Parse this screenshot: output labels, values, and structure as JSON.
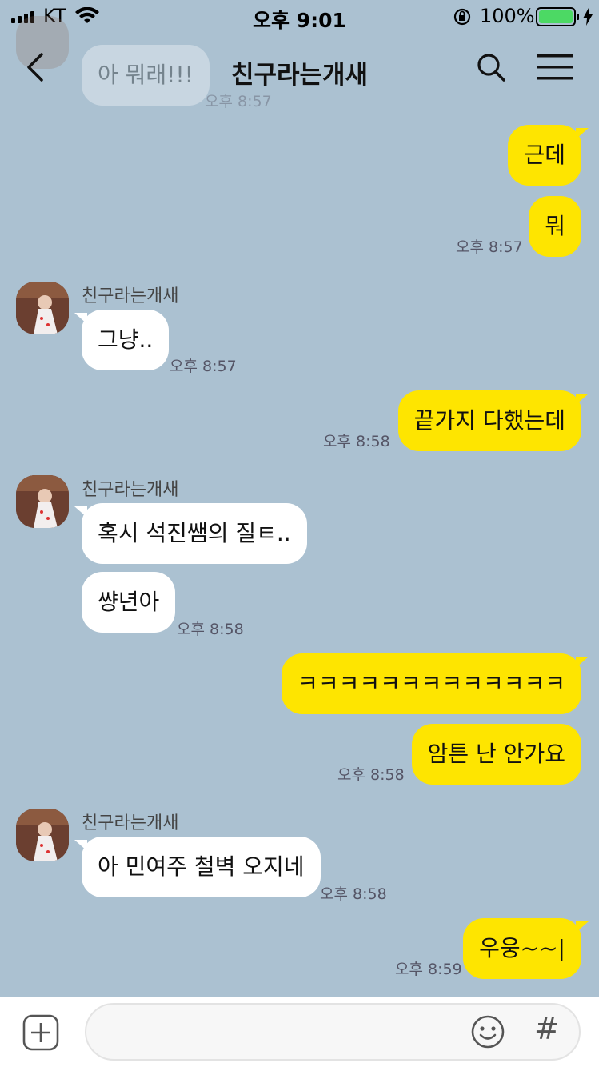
{
  "status_bar": {
    "carrier": "KT",
    "time": "오후 9:01",
    "battery": "100%"
  },
  "header": {
    "title": "친구라는개새"
  },
  "messages": [
    {
      "sender": "",
      "text": "아 뭐래!!!",
      "time": "오후 8:57"
    },
    {
      "text": "근데"
    },
    {
      "text": "뭐",
      "time": "오후 8:57"
    },
    {
      "sender": "친구라는개새",
      "text": "그냥..",
      "time": "오후 8:57"
    },
    {
      "text": "끝가지 다했는데",
      "time": "오후 8:58"
    },
    {
      "sender": "친구라는개새",
      "text": "혹시 석진쌤의 질ㅌ.."
    },
    {
      "text": "썅년아",
      "time": "오후 8:58"
    },
    {
      "text": "ㅋㅋㅋㅋㅋㅋㅋㅋㅋㅋㅋㅋㅋ"
    },
    {
      "text": "암튼 난 안가요",
      "time": "오후 8:58"
    },
    {
      "sender": "친구라는개새",
      "text": "아 민여주 철벽 오지네",
      "time": "오후 8:58"
    },
    {
      "text": "우웅~~|",
      "time": "오후 8:59"
    }
  ],
  "input": {
    "hash_label": "#"
  },
  "colors": {
    "background": "#abc1d1",
    "my_bubble": "#fee500",
    "their_bubble": "#ffffff"
  }
}
